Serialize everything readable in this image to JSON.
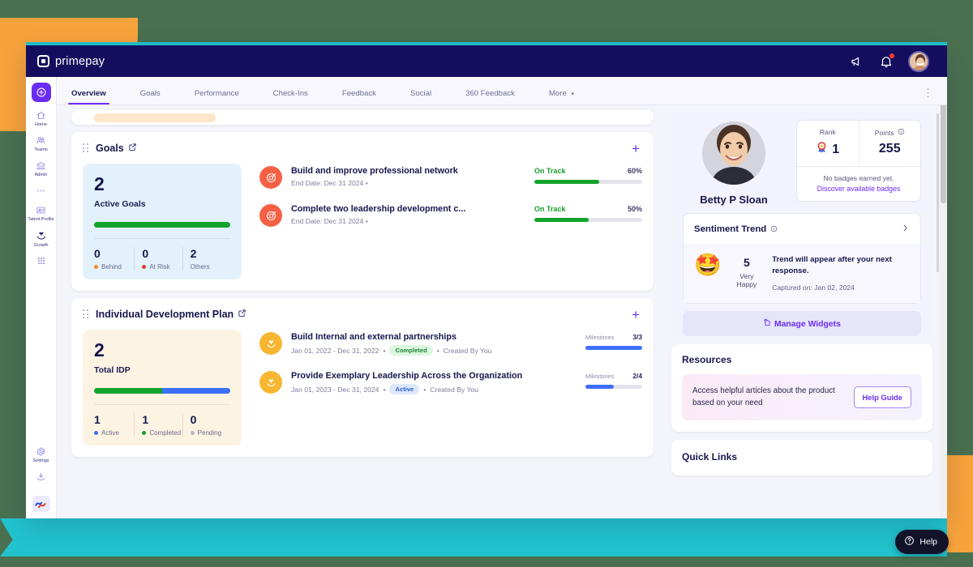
{
  "brand": {
    "name": "primepay",
    "logo_icon": "primepay-logo-mark",
    "navy": "#150e5e",
    "accent": "#6b2df5"
  },
  "header": {
    "announcement_icon": "megaphone-icon",
    "notification_icon": "bell-icon",
    "avatar_icon": "user-avatar"
  },
  "rail": {
    "add_icon": "plus-circle-icon",
    "items": [
      {
        "label": "Home",
        "icon": "home-icon"
      },
      {
        "label": "Teams",
        "icon": "teams-icon"
      },
      {
        "label": "Admin",
        "icon": "admin-bank-icon"
      },
      {
        "label": "",
        "icon": "more-dots-icon"
      },
      {
        "label": "Talent Profile",
        "icon": "talent-profile-icon"
      },
      {
        "label": "Growth",
        "icon": "growth-icon"
      },
      {
        "label": "",
        "icon": "grid-apps-icon"
      }
    ],
    "bottom": [
      {
        "label": "Settings",
        "icon": "gear-icon"
      },
      {
        "label": "",
        "icon": "download-icon"
      }
    ],
    "brand_icon": "company-logo-icon"
  },
  "tabs": [
    {
      "label": "Overview",
      "active": true
    },
    {
      "label": "Goals",
      "active": false
    },
    {
      "label": "Performance",
      "active": false
    },
    {
      "label": "Check-Ins",
      "active": false
    },
    {
      "label": "Feedback",
      "active": false
    },
    {
      "label": "Social",
      "active": false
    },
    {
      "label": "360 Feedback",
      "active": false
    },
    {
      "label": "More",
      "active": false,
      "chevron": "⌄"
    }
  ],
  "tabs_overflow_icon": "vertical-dots-icon",
  "goals_widget": {
    "title": "Goals",
    "open_icon": "external-link-icon",
    "add_icon": "plus-icon",
    "summary": {
      "count": "2",
      "label": "Active Goals",
      "progress_percent": 100,
      "bar_color": "#12a32a",
      "stats": [
        {
          "value": "0",
          "label": "Behind",
          "color": "#f08a24"
        },
        {
          "value": "0",
          "label": "At Risk",
          "color": "#e8392f"
        },
        {
          "value": "2",
          "label": "Others",
          "color": ""
        }
      ]
    },
    "items": [
      {
        "icon": "goal-target-icon",
        "title": "Build and improve professional network",
        "subtitle": "End Date: Dec 31 2024  •",
        "status": "On Track",
        "percent": "60%",
        "progress": 60
      },
      {
        "icon": "goal-target-icon",
        "title": "Complete two leadership development c...",
        "subtitle": "End Date: Dec 31 2024  •",
        "status": "On Track",
        "percent": "50%",
        "progress": 50
      }
    ]
  },
  "idp_widget": {
    "title": "Individual Development Plan",
    "open_icon": "external-link-icon",
    "add_icon": "plus-icon",
    "summary": {
      "count": "2",
      "label": "Total IDP",
      "segments": [
        {
          "percent": 50,
          "color": "#12a32a"
        },
        {
          "percent": 50,
          "color": "#3b6ff5"
        }
      ],
      "stats": [
        {
          "value": "1",
          "label": "Active",
          "color": "#3b6ff5"
        },
        {
          "value": "1",
          "label": "Completed",
          "color": "#12a32a"
        },
        {
          "value": "0",
          "label": "Pending",
          "color": "#b8b8cc"
        }
      ]
    },
    "items": [
      {
        "icon": "idp-plant-icon",
        "title": "Build Internal and external partnerships",
        "dates": "Jan 01, 2022 - Dec 31, 2022",
        "chip": "Completed",
        "chip_type": "completed",
        "created_by": "Created By You",
        "milestones_label": "Milestones",
        "milestones_value": "3/3",
        "progress": 100
      },
      {
        "icon": "idp-plant-icon",
        "title": "Provide Exemplary Leadership Across the Organization",
        "dates": "Jan 01, 2023 - Dec 31, 2024",
        "chip": "Active",
        "chip_type": "active",
        "created_by": "Created By You",
        "milestones_label": "Milestones",
        "milestones_value": "2/4",
        "progress": 50
      }
    ]
  },
  "profile": {
    "avatar_icon": "user-avatar-large",
    "name": "Betty P Sloan",
    "rank_label": "Rank",
    "rank_icon": "rosette-award-icon",
    "rank_value": "1",
    "points_label": "Points",
    "points_info_icon": "info-icon",
    "points_value": "255",
    "badges_text": "No badges earned yet.",
    "badges_link": "Discover available badges"
  },
  "sentiment": {
    "title": "Sentiment Trend",
    "info_icon": "info-icon",
    "chevron_icon": "chevron-right-icon",
    "emoji": "🤩",
    "score": "5",
    "score_label": "Very Happy",
    "message": "Trend will appear after your next response.",
    "captured": "Captured on: Jan 02, 2024"
  },
  "manage_widgets": {
    "label": "Manage Widgets",
    "icon": "widgets-icon"
  },
  "resources": {
    "title": "Resources",
    "text": "Access helpful articles about the product based on your need",
    "button": "Help Guide"
  },
  "quick_links": {
    "title": "Quick Links"
  },
  "help_button": {
    "label": "Help",
    "icon": "question-circle-icon"
  }
}
